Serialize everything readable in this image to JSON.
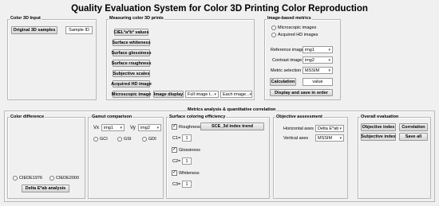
{
  "title": "Quality Evaluation System for Color 3D Printing Color Reproduction",
  "color_input": {
    "title": "Color 3D Input",
    "original_btn": "Original 3D samples",
    "sample_id": "Sample ID"
  },
  "measuring": {
    "title": "Measuring color 3D prints",
    "buttons": [
      "CIEL*a*b* values",
      "Surface whiteness",
      "Surface glossiness",
      "Surface roughness",
      "Subjective scales",
      "Acquired HD image",
      "Microscopic image"
    ],
    "image_display_btn": "Image display",
    "full_image": "Full image t...",
    "each_image": "Each image..."
  },
  "image_metrics": {
    "title": "Image-based metrics",
    "radio_microscopic": "Microscopic images",
    "radio_acquired": "Acquired HD images",
    "reference_label": "Reference image",
    "reference_value": "img1",
    "contrast_label": "Contrast image",
    "contrast_value": "img2",
    "metric_label": "Metric selection",
    "metric_value": "MSSIM",
    "calculation_btn": "Calculation",
    "value_text": "value",
    "display_save_btn": "Display and save in order"
  },
  "bottom_title": "Metrics analysis & quantitative correlation",
  "color_difference": {
    "title": "Color difference",
    "radio_1976": "CIEDE1976",
    "radio_2000": "CIEDE2000",
    "analysis_btn": "Delta E*ab analysis"
  },
  "gamut": {
    "title": "Gamut comparison",
    "vx_label": "Vx",
    "vx_value": "img1",
    "vy_label": "Vy",
    "vy_value": "img2",
    "gci": "GCI",
    "gsi": "GSI",
    "gdi": "GDI"
  },
  "surface": {
    "title": "Surface coloring efficiency",
    "roughness": "Roughness",
    "glossiness": "Glossiness",
    "whiteness": "Whiteness",
    "trend_btn": "SCE_3d index trend",
    "c1_label": "C1=",
    "c1_value": "1",
    "c2_label": "C2=",
    "c2_value": "1",
    "c3_label": "C3=",
    "c3_value": "1"
  },
  "objective": {
    "title": "Objective assessment",
    "horizontal_label": "Horizontal axes",
    "horizontal_value": "Delta E*ab",
    "vertical_label": "Vertical axes",
    "vertical_value": "MSSIM"
  },
  "overall": {
    "title": "Overall evaluation",
    "objective_btn": "Objective index",
    "correlation_btn": "Correlation",
    "subjective_btn": "Subjective index",
    "save_btn": "Save all"
  }
}
